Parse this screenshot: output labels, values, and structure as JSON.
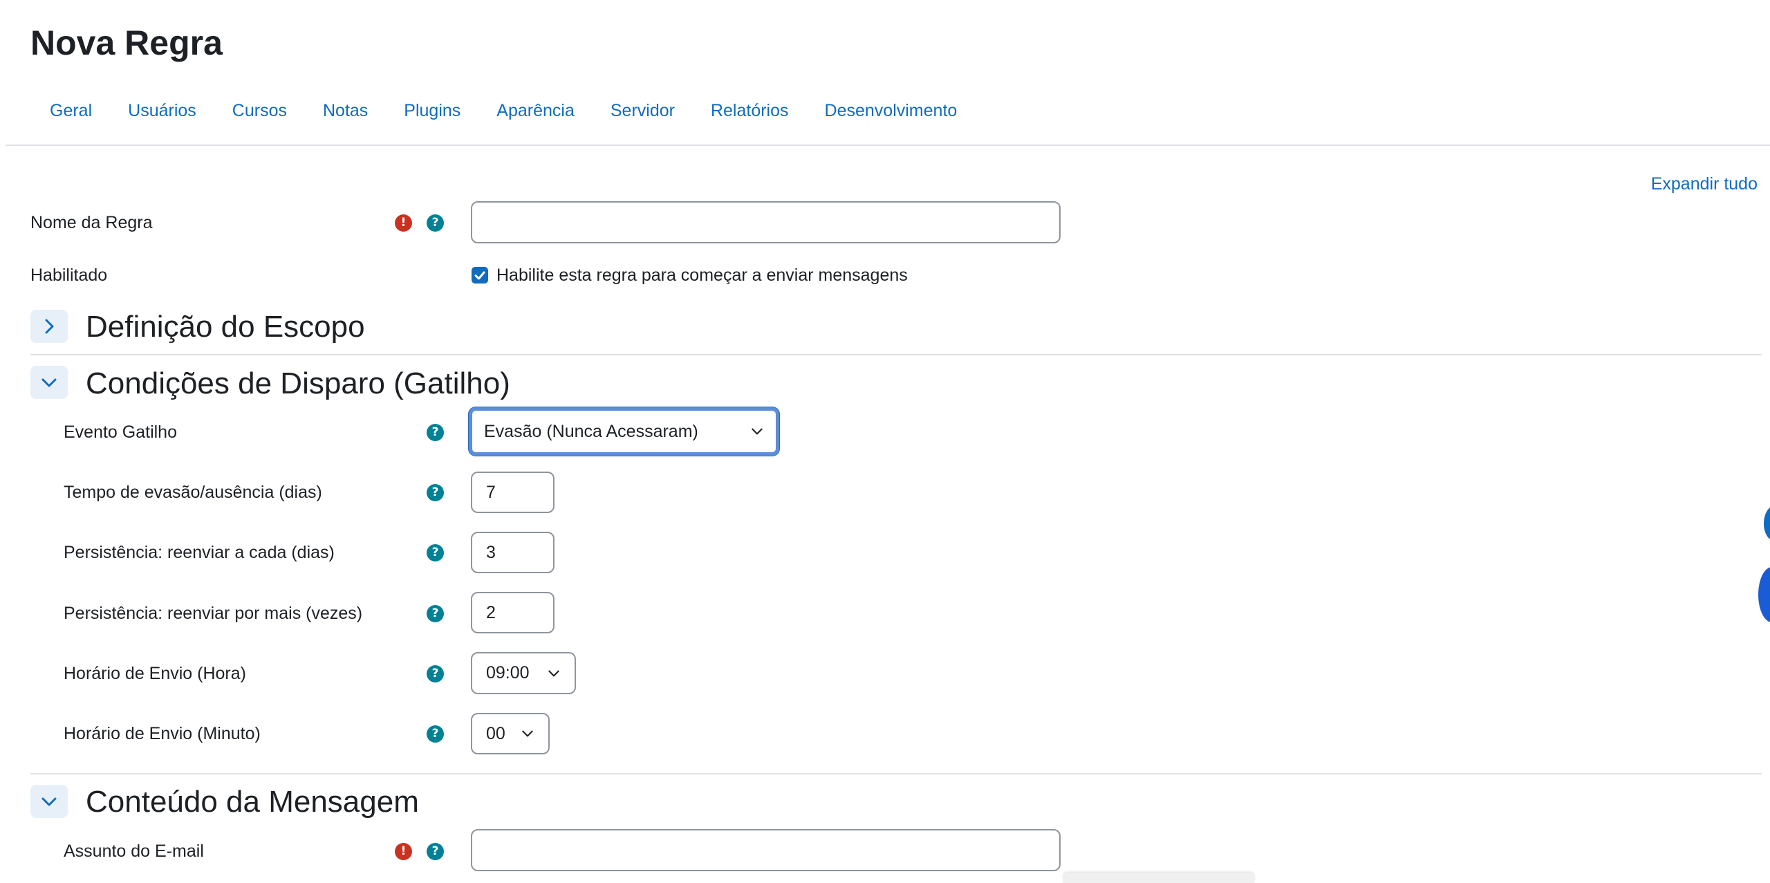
{
  "page": {
    "title": "Nova Regra"
  },
  "nav": {
    "tabs": [
      {
        "label": "Geral"
      },
      {
        "label": "Usuários"
      },
      {
        "label": "Cursos"
      },
      {
        "label": "Notas"
      },
      {
        "label": "Plugins"
      },
      {
        "label": "Aparência"
      },
      {
        "label": "Servidor"
      },
      {
        "label": "Relatórios"
      },
      {
        "label": "Desenvolvimento"
      }
    ]
  },
  "form": {
    "expand_all": "Expandir tudo",
    "rule_name": {
      "label": "Nome da Regra",
      "value": ""
    },
    "enabled": {
      "label": "Habilitado",
      "checkbox_label": "Habilite esta regra para começar a enviar mensagens",
      "checked": true
    },
    "scope_section": {
      "title": "Definição do Escopo",
      "expanded": false
    },
    "trigger_section": {
      "title": "Condições de Disparo (Gatilho)",
      "expanded": true,
      "event": {
        "label": "Evento Gatilho",
        "value": "Evasão (Nunca Acessaram)"
      },
      "dropout_days": {
        "label": "Tempo de evasão/ausência (dias)",
        "value": "7"
      },
      "resend_every": {
        "label": "Persistência: reenviar a cada (dias)",
        "value": "3"
      },
      "resend_times": {
        "label": "Persistência: reenviar por mais (vezes)",
        "value": "2"
      },
      "send_hour": {
        "label": "Horário de Envio (Hora)",
        "value": "09:00"
      },
      "send_minute": {
        "label": "Horário de Envio (Minuto)",
        "value": "00"
      }
    },
    "content_section": {
      "title": "Conteúdo da Mensagem",
      "expanded": true,
      "subject": {
        "label": "Assunto do E-mail",
        "value": ""
      }
    }
  },
  "icons": {
    "help": "help-icon",
    "required": "required-icon",
    "help_glyph": "?",
    "required_glyph": "!"
  },
  "colors": {
    "link": "#0f6cbf",
    "help": "#008196",
    "required": "#ca3120",
    "focus": "#5b8ed6"
  }
}
